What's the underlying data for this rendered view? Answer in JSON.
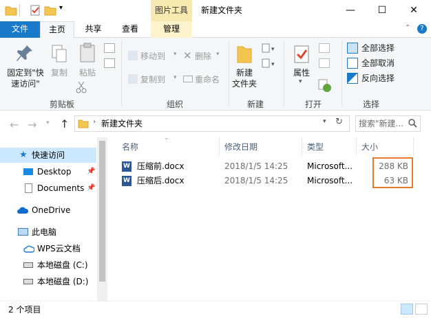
{
  "title": {
    "picture_tools": "图片工具",
    "folder_name": "新建文件夹",
    "min": "—",
    "max": "☐",
    "close": "✕"
  },
  "tabs": {
    "file": "文件",
    "home": "主页",
    "share": "共享",
    "view": "查看",
    "manage": "管理"
  },
  "ribbon": {
    "pin_quick_line1": "固定到\"快",
    "pin_quick_line2": "速访问\"",
    "copy": "复制",
    "paste": "粘贴",
    "clipboard_group": "剪贴板",
    "move_to": "移动到",
    "copy_to": "复制到",
    "delete": "删除",
    "rename": "重命名",
    "organize_group": "组织",
    "new_folder_line1": "新建",
    "new_folder_line2": "文件夹",
    "new_group": "新建",
    "properties": "属性",
    "open_group": "打开",
    "select_all": "全部选择",
    "select_none": "全部取消",
    "invert_select": "反向选择",
    "select_group": "选择"
  },
  "address": {
    "path": "新建文件夹",
    "search_placeholder": "搜索\"新建..."
  },
  "nav": {
    "quick_access": "快速访问",
    "desktop": "Desktop",
    "documents": "Documents",
    "onedrive": "OneDrive",
    "this_pc": "此电脑",
    "wps": "WPS云文档",
    "disk_c": "本地磁盘 (C:)",
    "disk_d": "本地磁盘 (D:)"
  },
  "columns": {
    "name": "名称",
    "modified": "修改日期",
    "type": "类型",
    "size": "大小"
  },
  "files": [
    {
      "name": "压缩前.docx",
      "modified": "2018/1/5 14:25",
      "type": "Microsoft...",
      "size": "288 KB"
    },
    {
      "name": "压缩后.docx",
      "modified": "2018/1/5 14:25",
      "type": "Microsoft...",
      "size": "63 KB"
    }
  ],
  "status": {
    "item_count": "2 个项目"
  },
  "colors": {
    "accent": "#1979ca",
    "highlight_box": "#e57a2b",
    "selected_nav": "#cce8ff"
  }
}
